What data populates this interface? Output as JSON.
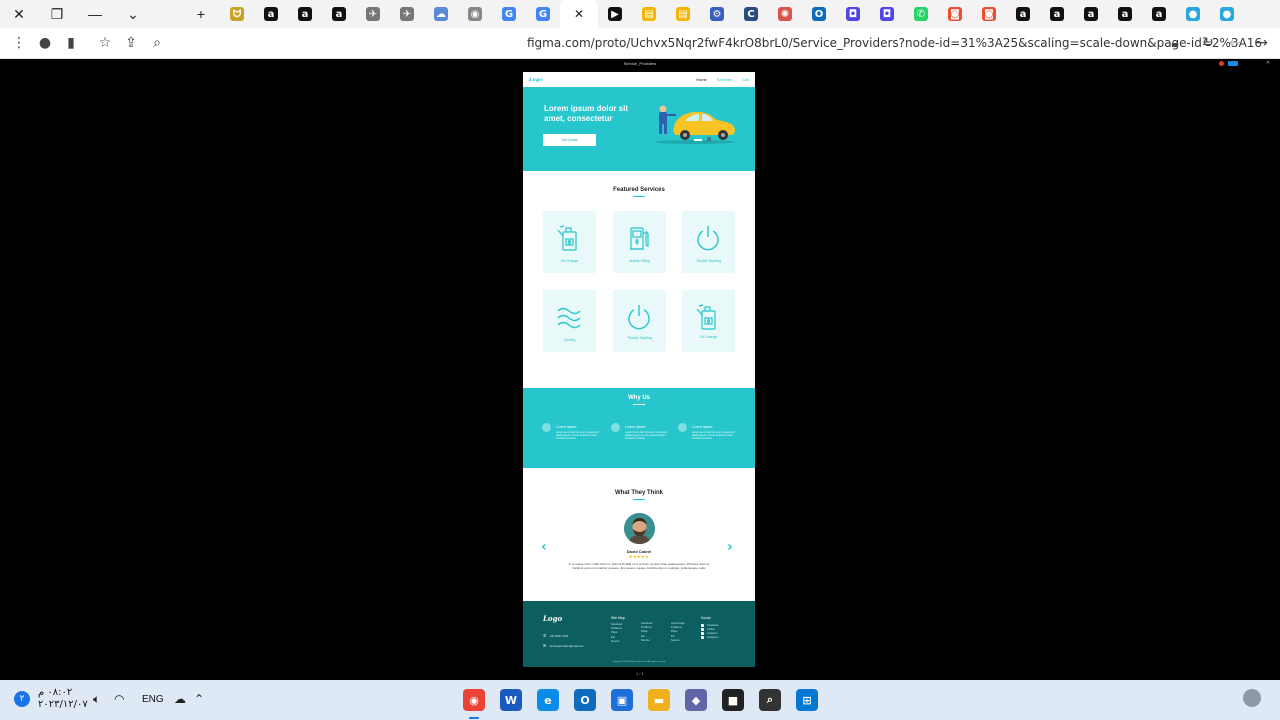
{
  "browser": {
    "window_controls": {
      "close": "✕",
      "restore": "❐",
      "minimize": "—",
      "dropdown": "⌄"
    },
    "new_tab": "+",
    "tabs": [
      {
        "icon": "person-icon",
        "glyph": "ᗢ",
        "color": "#c9a227"
      },
      {
        "icon": "amazon-icon",
        "glyph": "a",
        "color": "#111111"
      },
      {
        "icon": "amazon-icon",
        "glyph": "a",
        "color": "#111111"
      },
      {
        "icon": "amazon-icon",
        "glyph": "a",
        "color": "#111111"
      },
      {
        "icon": "plane-icon",
        "glyph": "✈",
        "color": "#777777"
      },
      {
        "icon": "plane-icon",
        "glyph": "✈",
        "color": "#777777"
      },
      {
        "icon": "cloud-icon",
        "glyph": "☁",
        "color": "#5b8bd6"
      },
      {
        "icon": "globe-icon",
        "glyph": "◉",
        "color": "#888888"
      },
      {
        "icon": "translate-icon",
        "glyph": "G",
        "color": "#4285f4"
      },
      {
        "icon": "translate-icon",
        "glyph": "G",
        "color": "#4285f4"
      },
      {
        "icon": "figma-icon",
        "glyph": "▶",
        "color": "#111111"
      },
      {
        "icon": "slides-icon",
        "glyph": "▤",
        "color": "#f4b400"
      },
      {
        "icon": "slides-icon",
        "glyph": "▤",
        "color": "#f4b400"
      },
      {
        "icon": "gear-icon",
        "glyph": "⚙",
        "color": "#3b5fc0"
      },
      {
        "icon": "c-icon",
        "glyph": "C",
        "color": "#2b4c7e"
      },
      {
        "icon": "bug-icon",
        "glyph": "✺",
        "color": "#d9534f"
      },
      {
        "icon": "outlook-icon",
        "glyph": "O",
        "color": "#0f6cbd"
      },
      {
        "icon": "dot-icon",
        "glyph": "◘",
        "color": "#4f46e5"
      },
      {
        "icon": "dot-icon",
        "glyph": "◘",
        "color": "#4f46e5"
      },
      {
        "icon": "whatsapp-icon",
        "glyph": "✆",
        "color": "#25d366"
      },
      {
        "icon": "shop-icon",
        "glyph": "◙",
        "color": "#ee4d2d"
      },
      {
        "icon": "shop-icon",
        "glyph": "◙",
        "color": "#ee4d2d"
      },
      {
        "icon": "amazon-icon",
        "glyph": "a",
        "color": "#111111"
      },
      {
        "icon": "amazon-icon",
        "glyph": "a",
        "color": "#111111"
      },
      {
        "icon": "amazon-icon",
        "glyph": "a",
        "color": "#111111"
      },
      {
        "icon": "amazon-icon",
        "glyph": "a",
        "color": "#111111"
      },
      {
        "icon": "amazon-icon",
        "glyph": "a",
        "color": "#111111"
      },
      {
        "icon": "circle-icon",
        "glyph": "●",
        "color": "#29a8e0"
      },
      {
        "icon": "circle-icon",
        "glyph": "●",
        "color": "#29a8e0"
      }
    ],
    "active_tab_close": "✕",
    "url": "figma.com/proto/Uchvx5Nqr2fwF4krO8brL0/Service_Providers?node-id=31%3A25&scaling=scale-down&page-id=2%3A16"
  },
  "figma": {
    "frame_title": "Service_Providers",
    "page_counter": "1 / 1"
  },
  "site": {
    "logo": "Logo",
    "nav": [
      "Home",
      "Services",
      "Call"
    ],
    "hero": {
      "title": "Lorem ipsum dolor sit amet, consectetur",
      "button": "Get Quote"
    },
    "featured": {
      "title": "Featured Services",
      "services": [
        {
          "label": "Oil Change",
          "icon": "oil-can-icon"
        },
        {
          "label": "Mobile Filling",
          "icon": "fuel-pump-icon"
        },
        {
          "label": "Trouble Starting",
          "icon": "power-icon"
        },
        {
          "label": "Cooling",
          "icon": "waves-icon"
        },
        {
          "label": "Trouble Starting",
          "icon": "power-icon"
        },
        {
          "label": "Oil Change",
          "icon": "oil-can-icon"
        }
      ]
    },
    "why_us": {
      "title": "Why Us",
      "items": [
        {
          "title": "Lorem Ipsum",
          "text": "Lorem ipsum dolor sit amet, consectetur adipiscing elit, sed do eiusmod tempor incididunt ut labore"
        },
        {
          "title": "Lorem Ipsum",
          "text": "Lorem ipsum dolor sit amet, consectetur adipiscing elit, sed do eiusmod tempor incididunt ut labore"
        },
        {
          "title": "Lorem Ipsum",
          "text": "Lorem ipsum dolor sit amet, consectetur adipiscing elit, sed do eiusmod tempor incididunt ut labore"
        }
      ]
    },
    "testimonials": {
      "title": "What They Think",
      "name": "David Cabrel",
      "stars": "★★★★★",
      "quote": "In a massa nunc mollis dolor id. Quis id fringilla mi in at dolor semper vitae pellentesque. Pharetra vitae ac tincidunt purus id curabitur posuere. Et posuere massa, condimentum in volutpat, pellentesque nulla.",
      "prev": "‹",
      "next": "›"
    },
    "footer": {
      "logo": "Logo",
      "phone": "+02 2000 1234",
      "email": "servicesprovider@mail.com",
      "columns": [
        {
          "heading": "Site Map",
          "links": [
            "Facebook",
            "Problems",
            "Place",
            "Etc",
            "Service"
          ]
        },
        {
          "heading": "",
          "links": [
            "Facebook",
            "Problems",
            "Place",
            "Etc",
            "Service"
          ]
        },
        {
          "heading": "",
          "links": [
            "Home Page",
            "Problems",
            "Place",
            "Etc",
            "Service"
          ]
        }
      ],
      "social_heading": "Social",
      "social": [
        "Facebook",
        "Twitter",
        "Linked In",
        "Instagram"
      ],
      "copyright": "Copyright 2022 All Rights Reserved. All rights reserved."
    }
  },
  "taskbar": {
    "time": "٠٨:٠٢ م",
    "date": "٢٠٢٣/١٢/٠٧",
    "lang": "ENG",
    "apps": [
      {
        "name": "chrome-icon",
        "glyph": "◉",
        "color": "#ea4335"
      },
      {
        "name": "word-icon",
        "glyph": "W",
        "color": "#185abd"
      },
      {
        "name": "edge-icon",
        "glyph": "e",
        "color": "#0c8ce9"
      },
      {
        "name": "outlook-icon",
        "glyph": "O",
        "color": "#0f6cbd"
      },
      {
        "name": "store-icon",
        "glyph": "▣",
        "color": "#1e6fd9"
      },
      {
        "name": "folder-icon",
        "glyph": "▬",
        "color": "#f2b01e"
      },
      {
        "name": "chat-icon",
        "glyph": "◆",
        "color": "#6264a7"
      },
      {
        "name": "terminal-icon",
        "glyph": "■",
        "color": "#222222"
      },
      {
        "name": "search-icon",
        "glyph": "⌕",
        "color": "#333333"
      },
      {
        "name": "windows-icon",
        "glyph": "⊞",
        "color": "#0078d4"
      }
    ]
  },
  "colors": {
    "accent": "#26c6cc",
    "footer": "#0d5e5e"
  }
}
